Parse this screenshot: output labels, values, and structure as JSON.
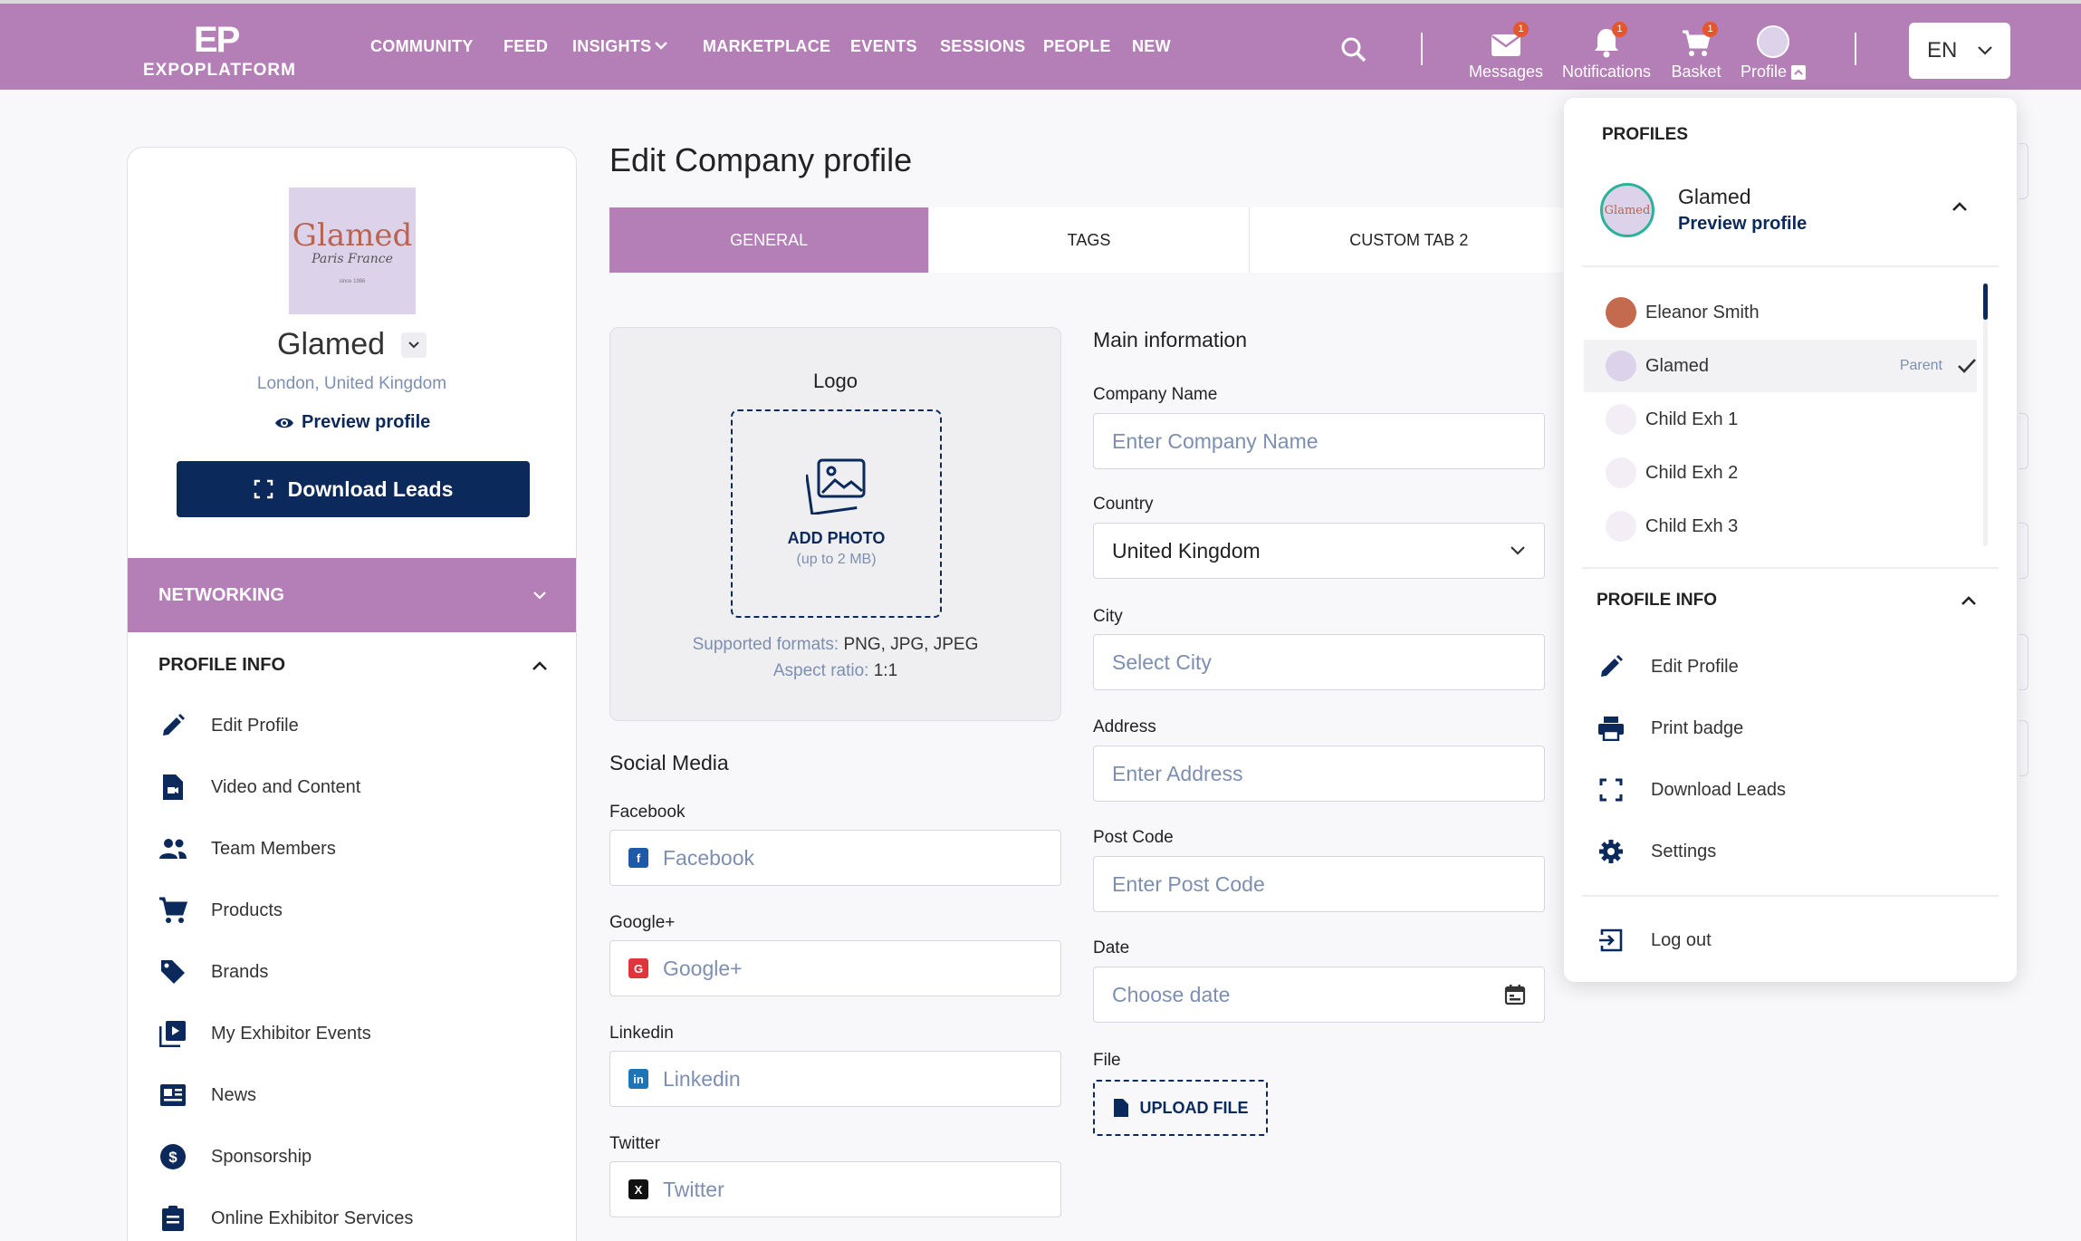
{
  "brand": {
    "mark": "EP",
    "name": "EXPOPLATFORM"
  },
  "nav": [
    "COMMUNITY",
    "FEED",
    "INSIGHTS",
    "MARKETPLACE",
    "EVENTS",
    "SESSIONS",
    "PEOPLE",
    "NEW"
  ],
  "toolbar": {
    "messages": "Messages",
    "notifications": "Notifications",
    "basket": "Basket",
    "profile": "Profile",
    "messages_badge": "1",
    "notifications_badge": "1",
    "basket_badge": "1",
    "lang": "EN"
  },
  "company": {
    "name": "Glamed",
    "logo_text": "Glamed",
    "logo_sub": "Paris France",
    "logo_since": "since 1986",
    "location": "London, United Kingdom",
    "preview": "Preview profile",
    "download_leads": "Download Leads"
  },
  "sidebar": {
    "networking": "NETWORKING",
    "profile_info": "PROFILE INFO",
    "items": [
      {
        "label": "Edit Profile",
        "icon": "pencil-icon"
      },
      {
        "label": "Video and Content",
        "icon": "video-file-icon"
      },
      {
        "label": "Team Members",
        "icon": "team-icon"
      },
      {
        "label": "Products",
        "icon": "cart-icon"
      },
      {
        "label": "Brands",
        "icon": "tag-icon"
      },
      {
        "label": "My Exhibitor Events",
        "icon": "playlist-icon"
      },
      {
        "label": "News",
        "icon": "news-icon"
      },
      {
        "label": "Sponsorship",
        "icon": "dollar-icon"
      },
      {
        "label": "Online Exhibitor Services",
        "icon": "clipboard-icon"
      }
    ]
  },
  "main": {
    "title": "Edit Company profile",
    "tabs": [
      "GENERAL",
      "TAGS",
      "CUSTOM TAB 2"
    ],
    "logo": {
      "title": "Logo",
      "add_photo": "ADD PHOTO",
      "limit": "(up to 2 MB)",
      "formats_label": "Supported formats:",
      "formats": "PNG, JPG, JPEG",
      "ratio_label": "Aspect ratio:",
      "ratio": "1:1"
    },
    "social": {
      "title": "Social Media",
      "fields": [
        {
          "label": "Facebook",
          "placeholder": "Facebook"
        },
        {
          "label": "Google+",
          "placeholder": "Google+"
        },
        {
          "label": "Linkedin",
          "placeholder": "Linkedin"
        },
        {
          "label": "Twitter",
          "placeholder": "Twitter"
        }
      ]
    },
    "info": {
      "title": "Main information",
      "company_label": "Company Name",
      "company_placeholder": "Enter Company Name",
      "country_label": "Country",
      "country_value": "United Kingdom",
      "city_label": "City",
      "city_placeholder": "Select City",
      "address_label": "Address",
      "address_placeholder": "Enter Address",
      "postcode_label": "Post Code",
      "postcode_placeholder": "Enter Post Code",
      "date_label": "Date",
      "date_placeholder": "Choose date",
      "file_label": "File",
      "upload": "UPLOAD FILE"
    }
  },
  "panel": {
    "profiles": "PROFILES",
    "current_name": "Glamed",
    "current_preview": "Preview profile",
    "list": [
      {
        "name": "Eleanor Smith",
        "tag": ""
      },
      {
        "name": "Glamed",
        "tag": "Parent"
      },
      {
        "name": "Child Exh 1",
        "tag": ""
      },
      {
        "name": "Child Exh 2",
        "tag": ""
      },
      {
        "name": "Child Exh 3",
        "tag": ""
      }
    ],
    "profile_info": "PROFILE INFO",
    "items": [
      "Edit Profile",
      "Print badge",
      "Download Leads",
      "Settings"
    ],
    "logout": "Log out"
  },
  "colors": {
    "accent": "#b47fb6",
    "navy": "#0b2a5b",
    "muted": "#7d8fb0",
    "badge": "#e4572e"
  }
}
